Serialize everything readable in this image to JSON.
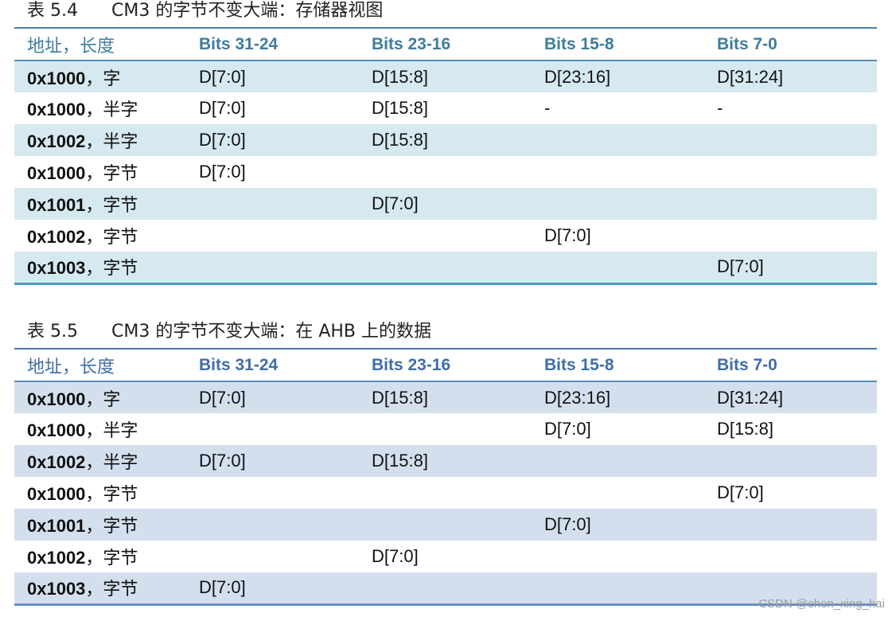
{
  "table1": {
    "caption_num": "表 5.4",
    "caption_text": "CM3 的字节不变大端：存储器视图",
    "headers": [
      "地址，长度",
      "Bits 31-24",
      "Bits 23-16",
      "Bits 15-8",
      "Bits 7-0"
    ],
    "rows": [
      {
        "addr": "0x1000",
        "len": "，字",
        "cells": [
          "D[7:0]",
          "D[15:8]",
          "D[23:16]",
          "D[31:24]"
        ]
      },
      {
        "addr": "0x1000",
        "len": "，半字",
        "cells": [
          "D[7:0]",
          "D[15:8]",
          "-",
          "-"
        ]
      },
      {
        "addr": "0x1002",
        "len": "，半字",
        "cells": [
          "D[7:0]",
          "D[15:8]",
          "",
          ""
        ]
      },
      {
        "addr": "0x1000",
        "len": "，字节",
        "cells": [
          "D[7:0]",
          "",
          "",
          ""
        ]
      },
      {
        "addr": "0x1001",
        "len": "，字节",
        "cells": [
          "",
          "D[7:0]",
          "",
          ""
        ]
      },
      {
        "addr": "0x1002",
        "len": "，字节",
        "cells": [
          "",
          "",
          "D[7:0]",
          ""
        ]
      },
      {
        "addr": "0x1003",
        "len": "，字节",
        "cells": [
          "",
          "",
          "",
          "D[7:0]"
        ]
      }
    ]
  },
  "table2": {
    "caption_num": "表 5.5",
    "caption_text": "CM3 的字节不变大端：在 AHB 上的数据",
    "headers": [
      "地址，长度",
      "Bits 31-24",
      "Bits 23-16",
      "Bits 15-8",
      "Bits 7-0"
    ],
    "rows": [
      {
        "addr": "0x1000",
        "len": "，字",
        "cells": [
          "D[7:0]",
          "D[15:8]",
          "D[23:16]",
          "D[31:24]"
        ]
      },
      {
        "addr": "0x1000",
        "len": "，半字",
        "cells": [
          "",
          "",
          "D[7:0]",
          "D[15:8]"
        ]
      },
      {
        "addr": "0x1002",
        "len": "，半字",
        "cells": [
          "D[7:0]",
          "D[15:8]",
          "",
          ""
        ]
      },
      {
        "addr": "0x1000",
        "len": "，字节",
        "cells": [
          "",
          "",
          "",
          "D[7:0]"
        ]
      },
      {
        "addr": "0x1001",
        "len": "，字节",
        "cells": [
          "",
          "",
          "D[7:0]",
          ""
        ]
      },
      {
        "addr": "0x1002",
        "len": "，字节",
        "cells": [
          "",
          "D[7:0]",
          "",
          ""
        ]
      },
      {
        "addr": "0x1003",
        "len": "，字节",
        "cells": [
          "D[7:0]",
          "",
          "",
          ""
        ]
      }
    ]
  },
  "watermark": "CSDN @chen_xing_hai"
}
